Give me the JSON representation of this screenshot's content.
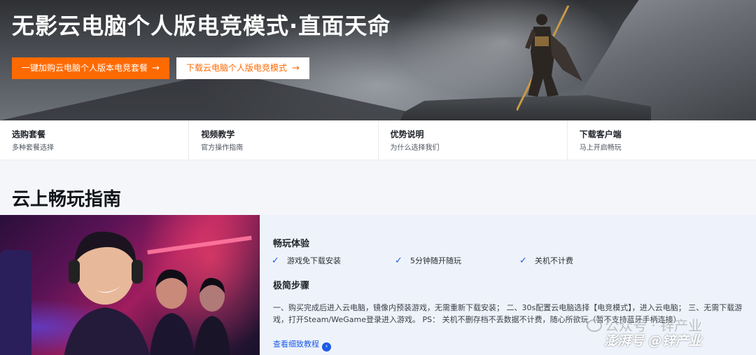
{
  "hero": {
    "title": "无影云电脑个人版电竞模式·直面天命",
    "primary_button": "一键加购云电脑个人版本电竞套餐",
    "secondary_button": "下载云电脑个人版电竞模式",
    "arrow": "→"
  },
  "quick_nav": [
    {
      "title": "选购套餐",
      "subtitle": "多种套餐选择"
    },
    {
      "title": "视频教学",
      "subtitle": "官方操作指南"
    },
    {
      "title": "优势说明",
      "subtitle": "为什么选择我们"
    },
    {
      "title": "下载客户端",
      "subtitle": "马上开启畅玩"
    }
  ],
  "section": {
    "title": "云上畅玩指南"
  },
  "guide": {
    "experience_heading": "畅玩体验",
    "features": [
      "游戏免下载安装",
      "5分钟随开随玩",
      "关机不计费"
    ],
    "steps_heading": "极简步骤",
    "steps_text": "一、购买完成后进入云电脑，镜像内预装游戏，无需重新下载安装； 二、30s配置云电脑选择【电竞模式】，进入云电脑； 三、无需下载游戏，打开Steam/WeGame登录进入游戏。 PS： 关机不删存档不丢数据不计费，随心所欲玩（暂不支持蓝牙手柄连接）",
    "more_link": "查看细致教程",
    "more_icon": "›"
  },
  "watermark": {
    "line1": "公众号 · 锌产业",
    "line2": "澎湃号 @锌产业"
  },
  "colors": {
    "accent_orange": "#ff6a00",
    "link_blue": "#1e5ae8",
    "panel_bg": "#eef3fb"
  },
  "icons": {
    "check": "check-icon",
    "arrow": "arrow-right-icon",
    "chevron": "chevron-right-circle-icon"
  }
}
